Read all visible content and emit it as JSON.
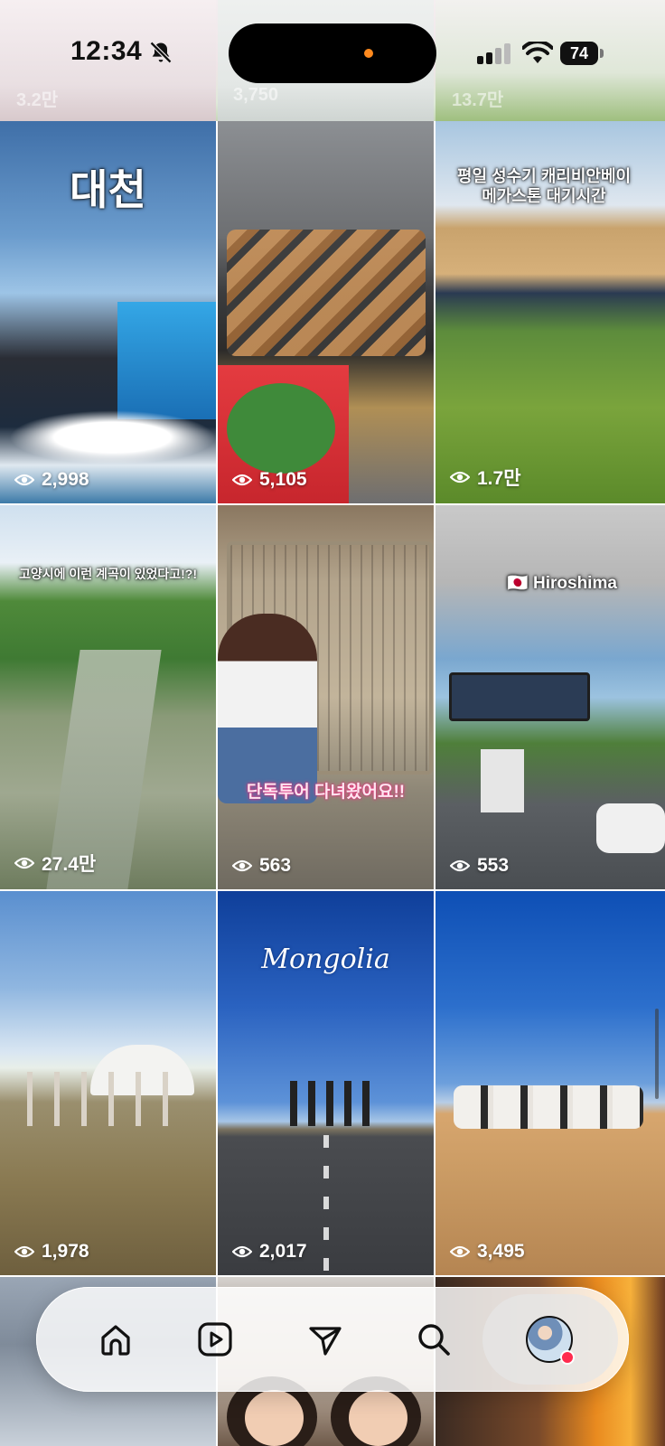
{
  "status_bar": {
    "time": "12:34",
    "battery": "74"
  },
  "top_row_views": [
    "3.2만",
    "3,750",
    "13.7만"
  ],
  "tiles": [
    {
      "overlay": "대천",
      "views": "2,998"
    },
    {
      "overlay": "",
      "views": "5,105"
    },
    {
      "overlay": "평일 성수기 캐리비안베이\n메가스톤 대기시간",
      "views": "1.7만"
    },
    {
      "overlay": "고양시에 이런 계곡이 있었다고!?!",
      "views": "27.4만"
    },
    {
      "overlay": "단독투어 다녀왔어요!!",
      "views": "563"
    },
    {
      "overlay": "Hiroshima",
      "views": "553"
    },
    {
      "overlay": "",
      "views": "1,978"
    },
    {
      "overlay": "Mongolia",
      "views": "2,017"
    },
    {
      "overlay": "",
      "views": "3,495"
    }
  ],
  "nav": {
    "items": [
      "home",
      "reels",
      "messages",
      "search",
      "profile"
    ]
  },
  "icons": {
    "status": [
      "bell-slash-icon",
      "cellular-signal-icon",
      "wifi-icon",
      "battery-icon"
    ],
    "nav": [
      "home-icon",
      "reels-icon",
      "send-icon",
      "search-icon",
      "avatar"
    ]
  }
}
